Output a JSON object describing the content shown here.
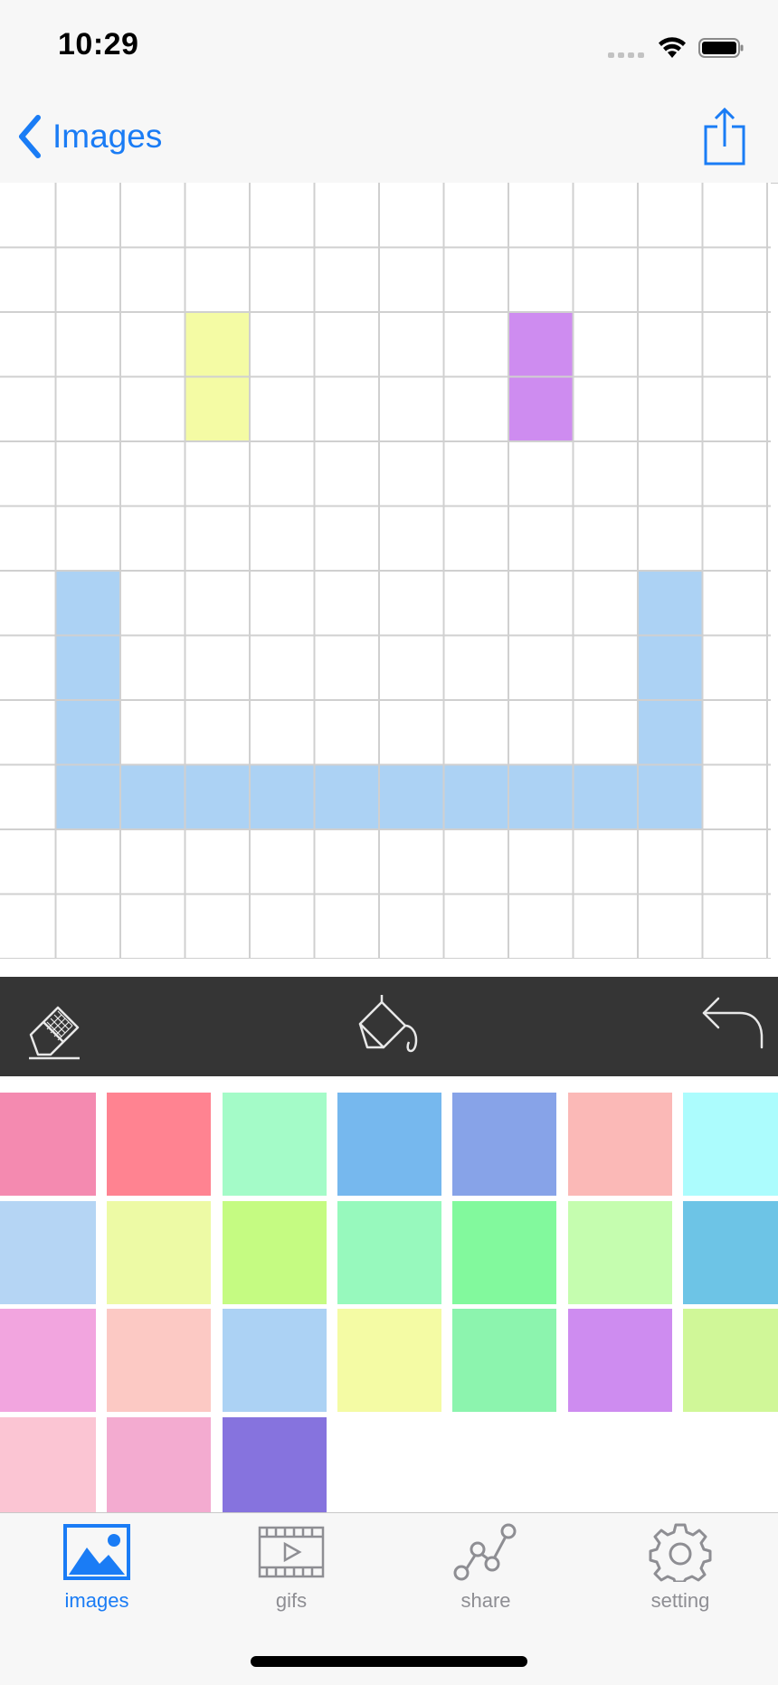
{
  "status_bar": {
    "time": "10:29"
  },
  "nav": {
    "back_label": "Images",
    "share_icon": "share-icon"
  },
  "canvas": {
    "columns": 12,
    "rows": 12,
    "filled_cells": [
      {
        "row": 2,
        "col": 3,
        "color": "#f4fba4"
      },
      {
        "row": 3,
        "col": 3,
        "color": "#f4fba4"
      },
      {
        "row": 2,
        "col": 8,
        "color": "#ce8cf0"
      },
      {
        "row": 3,
        "col": 8,
        "color": "#ce8cf0"
      },
      {
        "row": 6,
        "col": 1,
        "color": "#acd2f4"
      },
      {
        "row": 7,
        "col": 1,
        "color": "#acd2f4"
      },
      {
        "row": 8,
        "col": 1,
        "color": "#acd2f4"
      },
      {
        "row": 9,
        "col": 1,
        "color": "#acd2f4"
      },
      {
        "row": 6,
        "col": 10,
        "color": "#acd2f4"
      },
      {
        "row": 7,
        "col": 10,
        "color": "#acd2f4"
      },
      {
        "row": 8,
        "col": 10,
        "color": "#acd2f4"
      },
      {
        "row": 9,
        "col": 10,
        "color": "#acd2f4"
      },
      {
        "row": 9,
        "col": 2,
        "color": "#acd2f4"
      },
      {
        "row": 9,
        "col": 3,
        "color": "#acd2f4"
      },
      {
        "row": 9,
        "col": 4,
        "color": "#acd2f4"
      },
      {
        "row": 9,
        "col": 5,
        "color": "#acd2f4"
      },
      {
        "row": 9,
        "col": 6,
        "color": "#acd2f4"
      },
      {
        "row": 9,
        "col": 7,
        "color": "#acd2f4"
      },
      {
        "row": 9,
        "col": 8,
        "color": "#acd2f4"
      },
      {
        "row": 9,
        "col": 9,
        "color": "#acd2f4"
      }
    ]
  },
  "tools": {
    "eraser": "eraser-icon",
    "fill": "paint-bucket-icon",
    "undo": "undo-icon"
  },
  "palette": {
    "colors": [
      "#f48ab0",
      "#ff8391",
      "#a4fbc8",
      "#76b8ee",
      "#87a3e8",
      "#fbb9b7",
      "#acfcfd",
      "#b5d5f4",
      "#edfaa5",
      "#c5fb82",
      "#97f9bd",
      "#82f99d",
      "#c5fdaf",
      "#6dc4e6",
      "#f2a5df",
      "#fcc9c4",
      "#acd2f4",
      "#f4fba4",
      "#8cf4ae",
      "#ce8cf0",
      "#d0f798",
      "#fbc5d3",
      "#f3abd0",
      "#8673de"
    ]
  },
  "tabs": [
    {
      "label": "images",
      "icon": "image-icon",
      "active": true
    },
    {
      "label": "gifs",
      "icon": "film-icon",
      "active": false
    },
    {
      "label": "share",
      "icon": "share-nodes-icon",
      "active": false
    },
    {
      "label": "setting",
      "icon": "gear-icon",
      "active": false
    }
  ],
  "colors": {
    "accent": "#1a7cf5",
    "inactive": "#8e8e93",
    "toolbar": "#353535",
    "grid_line": "#d0d0d0"
  }
}
